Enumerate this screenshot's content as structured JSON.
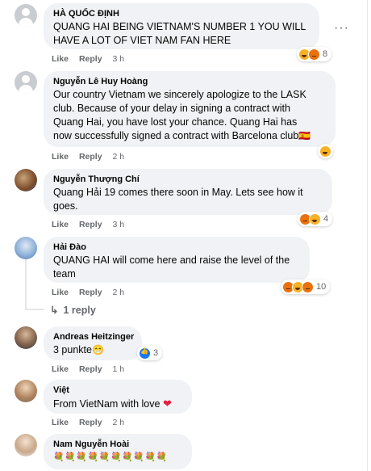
{
  "comments": [
    {
      "author": "HÀ QUỐC ĐỊNH",
      "lines": [
        "QUANG HAI BEING VIETNAM'S NUMBER 1 YOU WILL",
        "HAVE A LOT OF VIET NAM FAN HERE"
      ],
      "like": "Like",
      "reply": "Reply",
      "time": "3 h",
      "reactions": [
        "haha",
        "angry"
      ],
      "reaction_count": "8",
      "avatar": "default"
    },
    {
      "author": "Nguyễn Lê Huy Hoàng",
      "lines": [
        "Our country Vietnam we sincerely apologize to the LASK",
        "club. Because of your delay in signing a contract with",
        "Quang Hai, you have lost your chance. Quang Hai has",
        "now successfully signed a contract with Barcelona club"
      ],
      "flag": "🇪🇸",
      "like": "Like",
      "reply": "Reply",
      "time": "2 h",
      "reactions": [
        "haha"
      ],
      "reaction_count": "",
      "avatar": "default"
    },
    {
      "author": "Nguyễn Thượng Chí",
      "lines": [
        "Quang Hải 19 comes there soon in May. Lets see how it",
        "goes."
      ],
      "like": "Like",
      "reply": "Reply",
      "time": "3 h",
      "reactions": [
        "angry",
        "haha"
      ],
      "reaction_count": "4",
      "avatar": "photo"
    },
    {
      "author": "Hải Đào",
      "lines": [
        "QUANG HAI will come here and raise the level of the",
        "team"
      ],
      "like": "Like",
      "reply": "Reply",
      "time": "2 h",
      "reactions": [
        "angry",
        "haha",
        "angry"
      ],
      "reaction_count": "10",
      "avatar": "photo"
    },
    {
      "author": "Andreas Heitzinger",
      "lines": [
        "3 punkte"
      ],
      "emoji": "😁",
      "like": "Like",
      "reply": "Reply",
      "time": "1 h",
      "reactions": [
        "like"
      ],
      "reaction_count": "3",
      "avatar": "photo"
    },
    {
      "author": "Việt",
      "lines": [
        "From VietNam with love"
      ],
      "emoji": "❤",
      "like": "Like",
      "reply": "Reply",
      "time": "2 h",
      "reactions": [],
      "reaction_count": "",
      "avatar": "photo"
    },
    {
      "author": "Nam Nguyễn Hoài",
      "lines": [
        "💐💐💐💐💐💐💐💐💐💐"
      ],
      "like": "",
      "reply": "",
      "time": "",
      "reactions": [],
      "reaction_count": "",
      "avatar": "photo"
    }
  ],
  "reply_link": "1 reply",
  "more_menu": "···",
  "colors": {
    "bubble": "#f0f2f5",
    "meta": "#65676b",
    "like_blue": "#1877f2",
    "haha": "#f7b125",
    "angry": "#e9710f"
  }
}
